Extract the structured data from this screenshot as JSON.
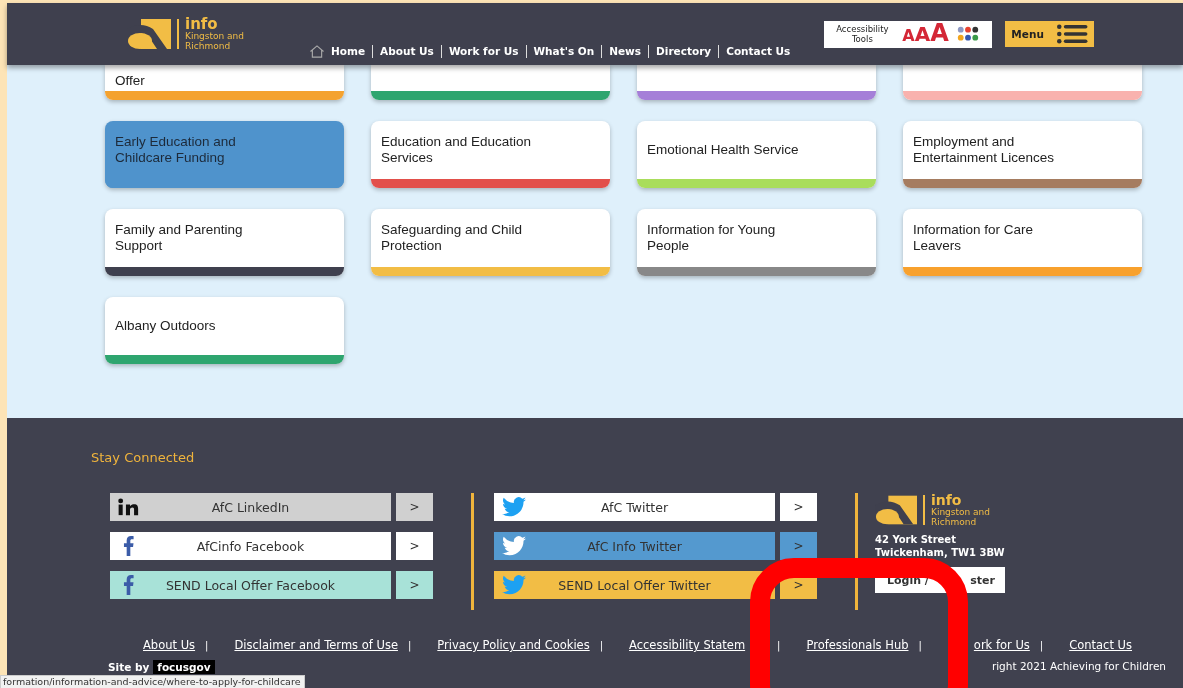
{
  "header": {
    "logo": {
      "title": "info",
      "subtitle": "Kingston and Richmond"
    },
    "nav": [
      {
        "label": "Home",
        "kind": "home"
      },
      {
        "label": "About Us",
        "kind": "link"
      },
      {
        "label": "Work for Us",
        "kind": "link"
      },
      {
        "label": "What's On",
        "kind": "link"
      },
      {
        "label": "News",
        "kind": "link"
      },
      {
        "label": "Directory",
        "kind": "link"
      },
      {
        "label": "Contact Us",
        "kind": "link"
      }
    ],
    "accessibility": {
      "label": "Accessibility Tools",
      "text_sizes": [
        "A",
        "A",
        "A"
      ]
    },
    "menu": {
      "label": "Menu"
    }
  },
  "cards": [
    {
      "kind": "partial",
      "title": "Offer",
      "color": "#f4a22f",
      "selected": false
    },
    {
      "kind": "partial",
      "color": "#2ea56f",
      "selected": false
    },
    {
      "kind": "partial",
      "color": "#a57fd8",
      "selected": false
    },
    {
      "kind": "partial",
      "color": "#f9b2ae",
      "selected": false
    },
    {
      "title": "Early Education and Childcare Funding",
      "color": "#4f93cc",
      "selected": true
    },
    {
      "title": "Education and Education Services",
      "color": "#e24f4a",
      "selected": false
    },
    {
      "title": "Emotional Health Service",
      "color": "#a9dd5b",
      "selected": false
    },
    {
      "title": "Employment and Entertainment Licences",
      "color": "#a57c60",
      "selected": false
    },
    {
      "title": "Family and Parenting Support",
      "color": "#3f404e",
      "selected": false
    },
    {
      "title": "Safeguarding and Child Protection",
      "color": "#f2bd45",
      "selected": false
    },
    {
      "title": "Information for Young People",
      "color": "#888888",
      "selected": false
    },
    {
      "title": "Information for Care Leavers",
      "color": "#f8a12d",
      "selected": false
    },
    {
      "title": "Albany Outdoors",
      "color": "#2ea56f",
      "selected": false
    }
  ],
  "footer": {
    "heading": "Stay Connected",
    "social_columns": [
      [
        {
          "kind": "linkedin",
          "label": "AfC LinkedIn",
          "arrow": ">",
          "color": "#d0d0d0"
        },
        {
          "kind": "facebook",
          "label": "AfCinfo Facebook",
          "arrow": ">",
          "color": "#ffffff"
        },
        {
          "kind": "facebook",
          "label": "SEND Local Offer Facebook",
          "arrow": ">",
          "color": "#a8e2d8"
        }
      ],
      [
        {
          "kind": "twitter",
          "label": "AfC Twitter",
          "arrow": ">",
          "color": "#ffffff"
        },
        {
          "kind": "twitter",
          "label": "AfC Info Twitter",
          "arrow": ">",
          "color": "#5499cf"
        },
        {
          "kind": "twitter",
          "label": "SEND Local Offer Twitter",
          "arrow": ">",
          "color": "#f2bd45"
        }
      ]
    ],
    "logo": {
      "title": "info",
      "subtitle": "Kingston and Richmond"
    },
    "address": [
      "42 York Street",
      "Twickenham, TW1 3BW"
    ],
    "login": {
      "text_start": "Login /",
      "text_end": "ster"
    },
    "links": [
      "About Us",
      "Disclaimer and Terms of Use",
      "Privacy Policy and Cookies",
      "Accessibility Statem",
      "Professionals Hub",
      "ork for Us",
      "Contact Us"
    ],
    "separator": "|",
    "site_by": {
      "label": "Site by",
      "brand": "focusgov"
    },
    "copyright": "right 2021 Achieving for Children"
  },
  "status_bar": {
    "url": "formation/information-and-advice/where-to-apply-for-childcare"
  }
}
